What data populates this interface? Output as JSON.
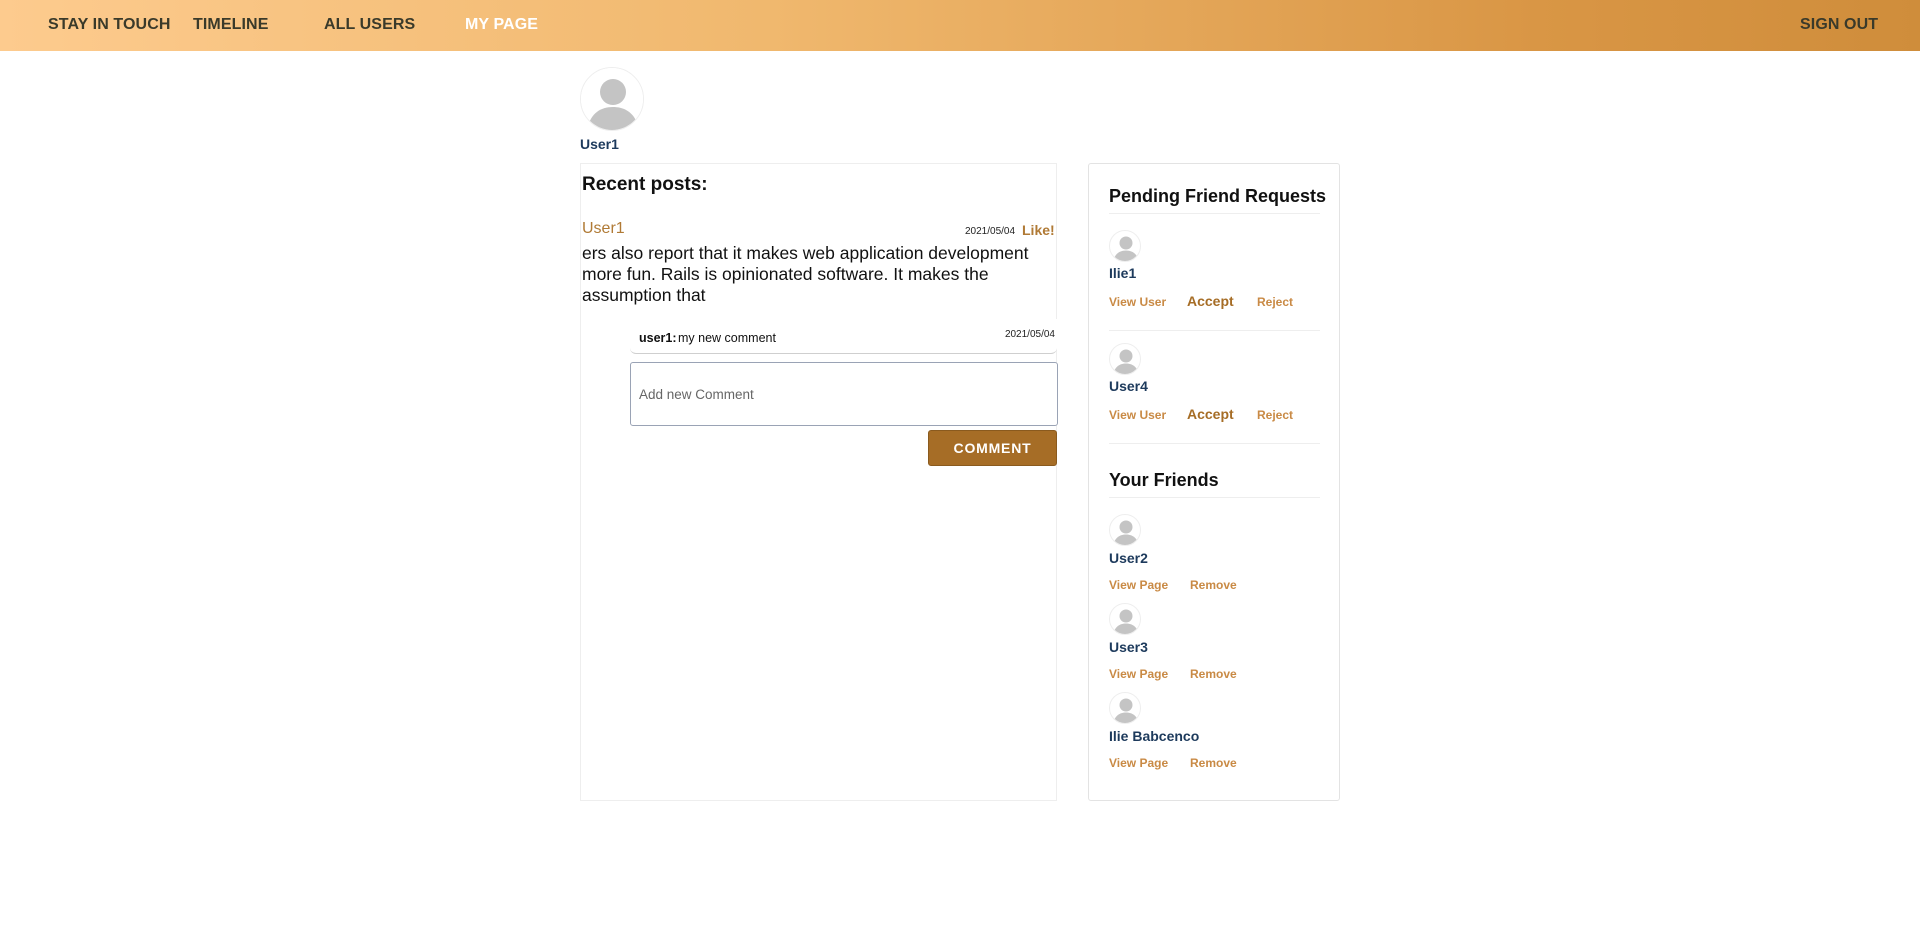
{
  "nav": {
    "brand": "STAY IN TOUCH",
    "timeline": "TIMELINE",
    "all_users": "ALL USERS",
    "my_page": "MY PAGE",
    "sign_out": "SIGN OUT"
  },
  "profile": {
    "name": "User1",
    "avatar_icon": "user-silhouette-icon"
  },
  "posts": {
    "title": "Recent posts:",
    "items": [
      {
        "author": "User1",
        "date": "2021/05/04",
        "like_label": "Like!",
        "body": "ers also report that it makes web application development more fun. Rails is opinionated software. It makes the assumption that",
        "comments": [
          {
            "author": "user1:",
            "text": "my new comment",
            "date": "2021/05/04"
          }
        ],
        "comment_placeholder": "Add new Comment",
        "comment_button": "COMMENT"
      }
    ]
  },
  "pending": {
    "title": "Pending Friend Requests",
    "items": [
      {
        "name": "Ilie1",
        "view": "View User",
        "accept": "Accept",
        "reject": "Reject"
      },
      {
        "name": "User4",
        "view": "View User",
        "accept": "Accept",
        "reject": "Reject"
      }
    ]
  },
  "friends": {
    "title": "Your Friends",
    "items": [
      {
        "name": "User2",
        "view": "View Page",
        "remove": "Remove"
      },
      {
        "name": "User3",
        "view": "View Page",
        "remove": "Remove"
      },
      {
        "name": "Ilie Babcenco",
        "view": "View Page",
        "remove": "Remove"
      }
    ]
  },
  "colors": {
    "accent": "#a66d26",
    "link": "#c98a45",
    "username": "#1d3a5c",
    "nav_gradient_start": "#fdcb8e",
    "nav_gradient_end": "#cf8d3b"
  }
}
